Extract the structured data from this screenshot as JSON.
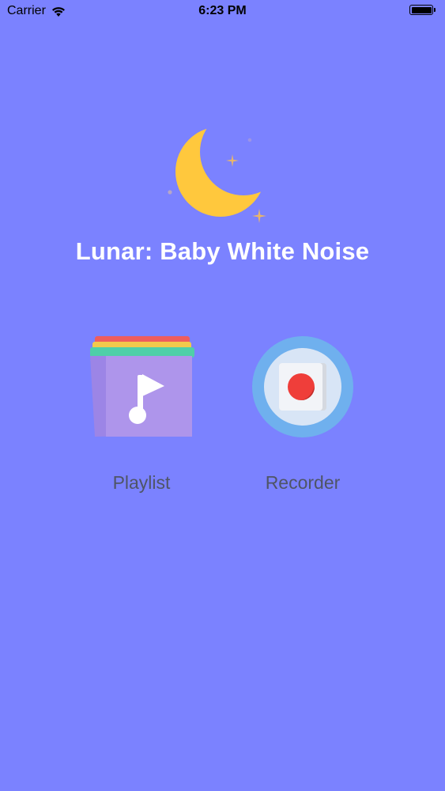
{
  "status_bar": {
    "carrier": "Carrier",
    "time": "6:23 PM",
    "wifi_icon": "wifi-icon",
    "battery_icon": "battery-icon"
  },
  "app": {
    "title": "Lunar: Baby White Noise",
    "logo_icon": "moon-stars-icon"
  },
  "menu": {
    "playlist": {
      "label": "Playlist",
      "icon": "music-folder-icon"
    },
    "recorder": {
      "label": "Recorder",
      "icon": "record-button-icon"
    }
  },
  "colors": {
    "background": "#7B82FF",
    "moon": "#FFC83D",
    "title_text": "#FFFFFF",
    "label_text": "#4F5566"
  }
}
